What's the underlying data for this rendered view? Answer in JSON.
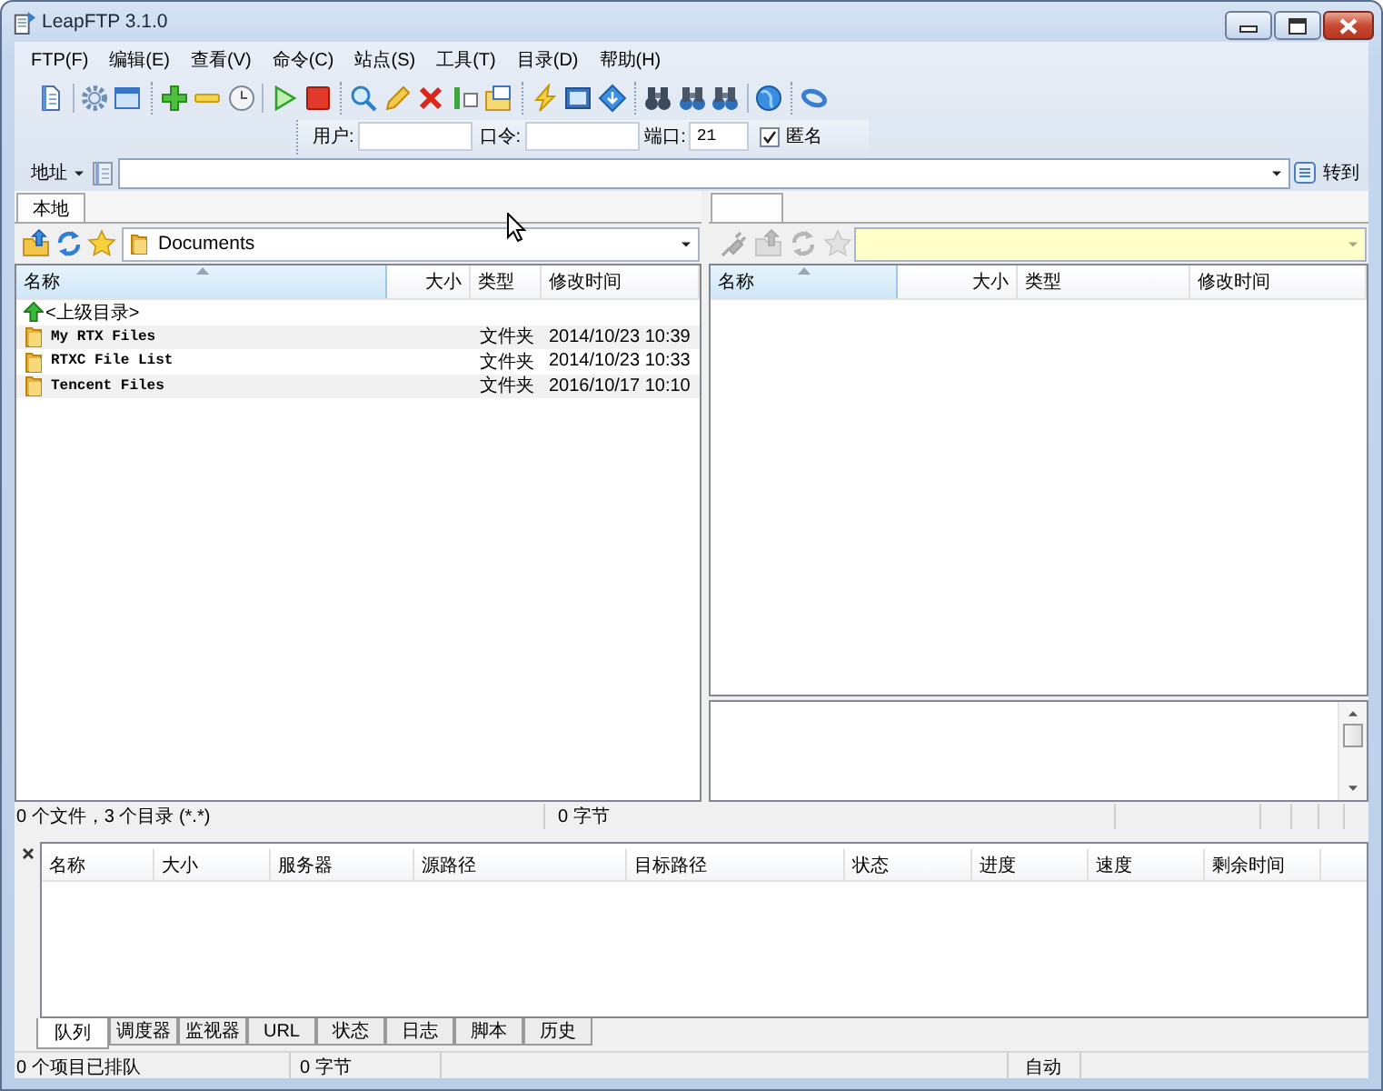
{
  "window": {
    "title": "LeapFTP 3.1.0"
  },
  "menu": [
    "FTP(F)",
    "编辑(E)",
    "查看(V)",
    "命令(C)",
    "站点(S)",
    "工具(T)",
    "目录(D)",
    "帮助(H)"
  ],
  "login_bar": {
    "user_label": "用户:",
    "password_label": "口令:",
    "port_label": "端口:",
    "port": "21",
    "anonymous": {
      "label": "匿名",
      "checked": true
    }
  },
  "address_bar": {
    "label": "地址",
    "go_label": "转到"
  },
  "local_panel": {
    "tab": "本地",
    "toolbar": {
      "disabled": false
    },
    "path": "Documents",
    "columns": [
      {
        "label": "名称",
        "sorted": true
      },
      {
        "label": "大小",
        "sorted": false
      },
      {
        "label": "类型",
        "sorted": false
      },
      {
        "label": "修改时间",
        "sorted": false
      }
    ],
    "rows": [
      {
        "kind": "parent",
        "name": "<上级目录>"
      },
      {
        "kind": "folder",
        "name": "My RTX Files",
        "type": "文件夹",
        "modified": "2014/10/23 10:39"
      },
      {
        "kind": "folder",
        "name": "RTXC File List",
        "type": "文件夹",
        "modified": "2014/10/23 10:33"
      },
      {
        "kind": "folder",
        "name": "Tencent Files",
        "type": "文件夹",
        "modified": "2016/10/17 10:10"
      }
    ],
    "status": {
      "summary": "0 个文件，3 个目录 (*.*)",
      "size": "0 字节"
    }
  },
  "remote_panel": {
    "toolbar": {
      "disabled": true
    },
    "columns": [
      {
        "label": "名称",
        "sorted": true
      },
      {
        "label": "大小",
        "sorted": false
      },
      {
        "label": "类型",
        "sorted": false
      },
      {
        "label": "修改时间",
        "sorted": false
      }
    ]
  },
  "queue": {
    "columns": [
      "名称",
      "大小",
      "服务器",
      "源路径",
      "目标路径",
      "状态",
      "进度",
      "速度",
      "剩余时间"
    ],
    "tabs": [
      {
        "label": "队列",
        "selected": true
      },
      {
        "label": "调度器",
        "selected": false
      },
      {
        "label": "监视器",
        "selected": false
      },
      {
        "label": "URL",
        "selected": false
      },
      {
        "label": "状态",
        "selected": false
      },
      {
        "label": "日志",
        "selected": false
      },
      {
        "label": "脚本",
        "selected": false
      },
      {
        "label": "历史",
        "selected": false
      }
    ]
  },
  "status_bar": {
    "queued": "0 个项目已排队",
    "size": "0 字节",
    "mode": "自动"
  }
}
